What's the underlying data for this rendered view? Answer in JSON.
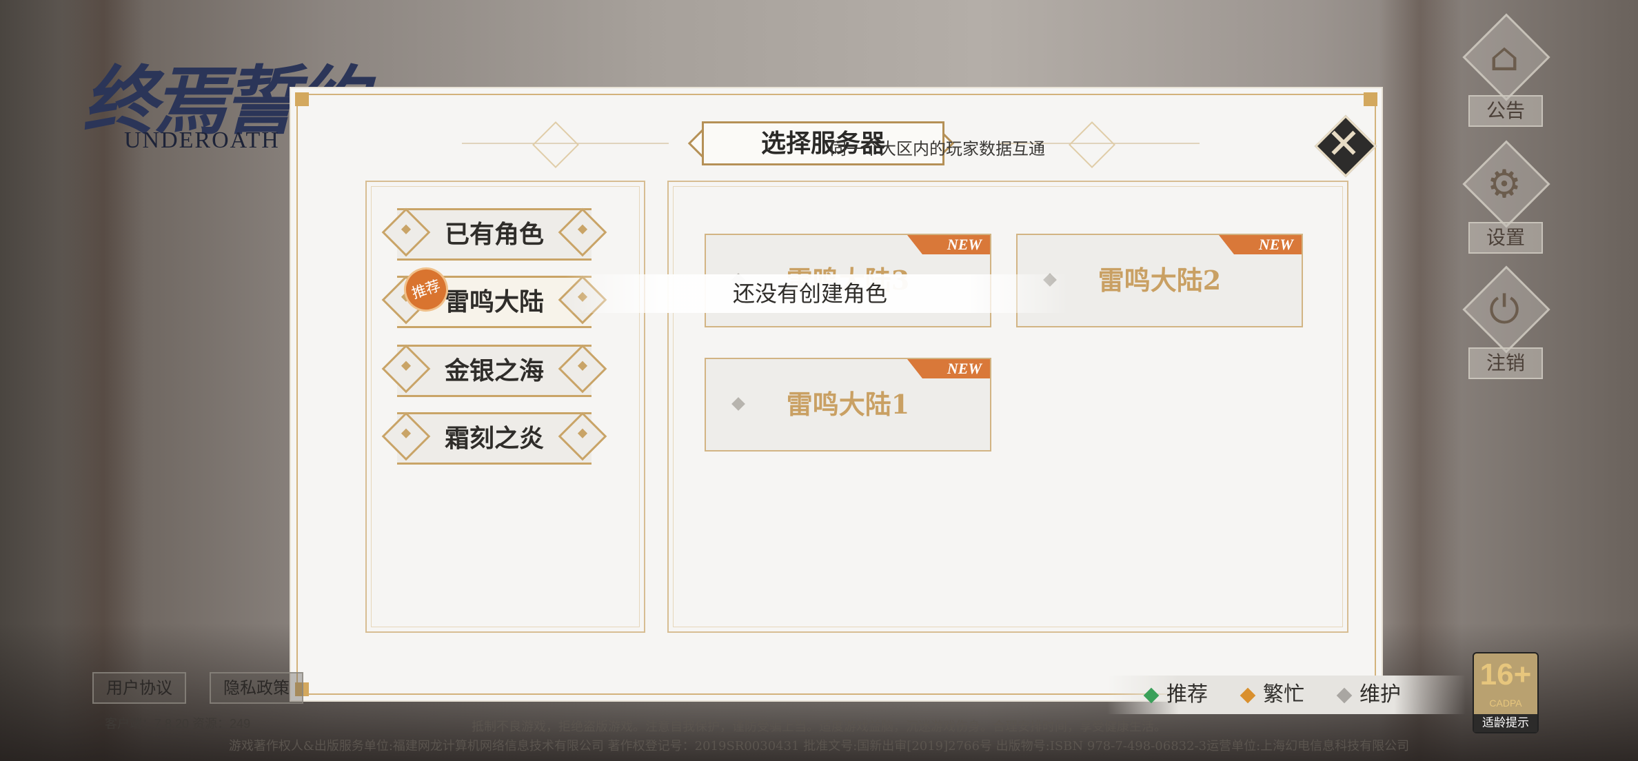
{
  "logo": {
    "cn": "终焉誓约",
    "en": "UNDEROATH"
  },
  "side_buttons": [
    {
      "label": "公告",
      "icon": "notice-icon",
      "glyph": "⌂"
    },
    {
      "label": "设置",
      "icon": "gear-icon",
      "glyph": "⚙"
    },
    {
      "label": "注销",
      "icon": "power-icon",
      "glyph": "⏻"
    }
  ],
  "dialog": {
    "title": "选择服务器",
    "close_glyph": "✕",
    "regions": [
      {
        "label": "已有角色",
        "active": false
      },
      {
        "label": "雷鸣大陆",
        "active": true,
        "badge": "推荐"
      },
      {
        "label": "金银之海",
        "active": false
      },
      {
        "label": "霜刻之炎",
        "active": false
      }
    ],
    "hint": "同一个大区内的玩家数据互通",
    "no_role": "还没有创建角色",
    "servers": [
      {
        "name": "雷鸣大陆3",
        "tag": "NEW"
      },
      {
        "name": "雷鸣大陆2",
        "tag": "NEW"
      },
      {
        "name": "雷鸣大陆1",
        "tag": "NEW"
      }
    ],
    "legend": [
      {
        "label": "推荐",
        "color": "#3aa05a"
      },
      {
        "label": "繁忙",
        "color": "#d9902e"
      },
      {
        "label": "维护",
        "color": "#a9a6a2"
      }
    ]
  },
  "footer": {
    "user_agreement": "用户协议",
    "privacy": "隐私政策",
    "version": "客户端：7.8.20  资源：249",
    "health": "抵制不良游戏，拒绝盗版游戏。注意自我保护，谨防受骗上当。适度游戏益脑，沉迷游戏伤身。合理安排时间，享受健康生活。",
    "copyright": "游戏著作权人&出版服务单位:福建网龙计算机网络信息技术有限公司  著作权登记号：2019SR0030431  批准文号:国新出审[2019]2766号  出版物号:ISBN 978-7-498-06832-3运营单位:上海幻电信息科技有限公司"
  },
  "age_rating": {
    "number": "16+",
    "org": "CADPA",
    "text": "适龄提示"
  }
}
